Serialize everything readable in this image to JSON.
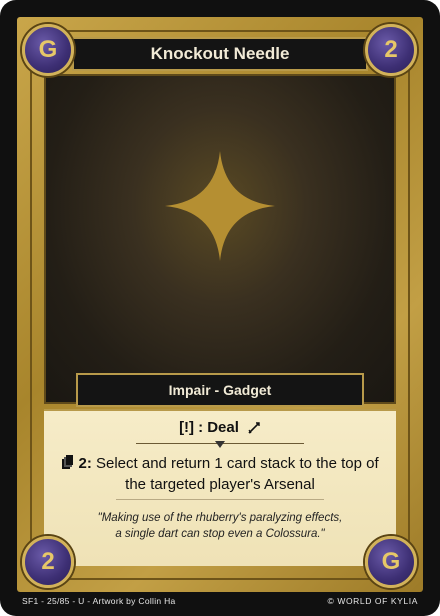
{
  "card": {
    "title": "Knockout Needle",
    "top_left_gem": "G",
    "top_right_gem": "2",
    "bottom_left_gem": "2",
    "bottom_right_gem": "G",
    "type_line": "Impair - Gadget",
    "cost_text": ": Deal",
    "cost_symbol": "[!]",
    "effect_number": "2:",
    "effect_text": "Select and return 1 card stack to the top of the targeted player's Arsenal",
    "flavor_line1": "\"Making use of the rhuberry's paralyzing effects,",
    "flavor_line2": "a single dart can stop even a Colossura.\"",
    "footer_left": "SF1 - 25/85 - U - Artwork by Collin Ha",
    "footer_right": "© WORLD OF KYLIA"
  },
  "icons": {
    "art": "four-point-star-icon",
    "cost": "exclamation-bracket-icon",
    "deal": "dart-icon",
    "effect": "card-stack-icon"
  },
  "colors": {
    "frame_gold": "#c9a64a",
    "gem_purple": "#3d2f74",
    "text_box": "#f6ecc8",
    "background": "#101010"
  }
}
